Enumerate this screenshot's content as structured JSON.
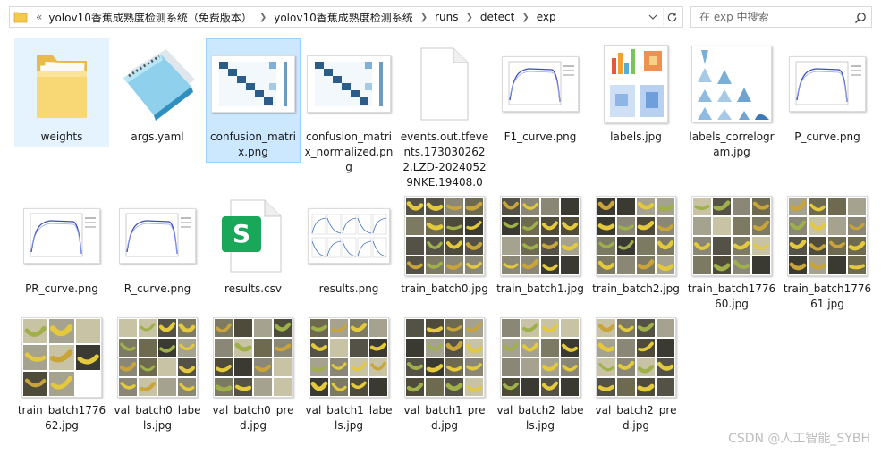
{
  "address_bar": {
    "overflow": "«",
    "crumbs": [
      "yolov10香蕉成熟度检测系统（免费版本）",
      "yolov10香蕉成熟度检测系统",
      "runs",
      "detect",
      "exp"
    ]
  },
  "search": {
    "placeholder": "在 exp 中搜索"
  },
  "files": [
    {
      "name": "weights",
      "kind": "folder"
    },
    {
      "name": "args.yaml",
      "kind": "notepad"
    },
    {
      "name": "confusion_matrix.png",
      "kind": "confusion"
    },
    {
      "name": "confusion_matrix_normalized.png",
      "kind": "confusion"
    },
    {
      "name": "events.out.tfevents.1730302622.LZD-20240529NKE.19408.0",
      "kind": "blank"
    },
    {
      "name": "F1_curve.png",
      "kind": "curve"
    },
    {
      "name": "labels.jpg",
      "kind": "labels"
    },
    {
      "name": "labels_correlogram.jpg",
      "kind": "correlogram"
    },
    {
      "name": "P_curve.png",
      "kind": "curve"
    },
    {
      "name": "PR_curve.png",
      "kind": "curve"
    },
    {
      "name": "R_curve.png",
      "kind": "curve"
    },
    {
      "name": "results.csv",
      "kind": "csv"
    },
    {
      "name": "results.png",
      "kind": "results"
    },
    {
      "name": "train_batch0.jpg",
      "kind": "mosaic"
    },
    {
      "name": "train_batch1.jpg",
      "kind": "mosaic"
    },
    {
      "name": "train_batch2.jpg",
      "kind": "mosaic"
    },
    {
      "name": "train_batch177660.jpg",
      "kind": "mosaic"
    },
    {
      "name": "train_batch177661.jpg",
      "kind": "mosaic"
    },
    {
      "name": "train_batch177662.jpg",
      "kind": "mosaic3"
    },
    {
      "name": "val_batch0_labels.jpg",
      "kind": "mosaic"
    },
    {
      "name": "val_batch0_pred.jpg",
      "kind": "mosaic"
    },
    {
      "name": "val_batch1_labels.jpg",
      "kind": "mosaic"
    },
    {
      "name": "val_batch1_pred.jpg",
      "kind": "mosaic"
    },
    {
      "name": "val_batch2_labels.jpg",
      "kind": "mosaic"
    },
    {
      "name": "val_batch2_pred.jpg",
      "kind": "mosaic"
    }
  ],
  "selected_index": 2,
  "hover_index": 0,
  "watermark": "CSDN @人工智能_SYBH",
  "colors": {
    "selection_bg": "#cce8ff",
    "selection_border": "#99d1ff",
    "folder": "#f8d775",
    "banana_yellow": "#e3c93b",
    "banana_green": "#9fb04a",
    "csv_green": "#19a85a"
  }
}
